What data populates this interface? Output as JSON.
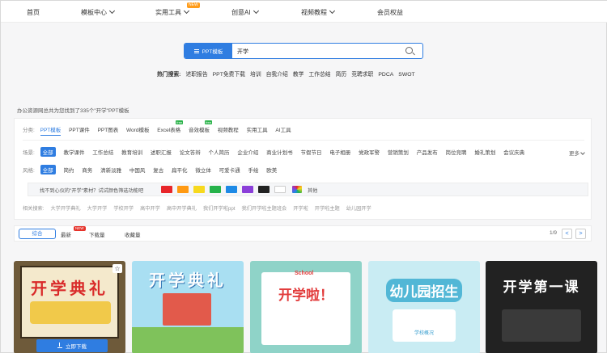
{
  "nav": {
    "items": [
      {
        "label": "首页",
        "chevron": false
      },
      {
        "label": "模板中心",
        "chevron": true
      },
      {
        "label": "实用工具",
        "chevron": true
      },
      {
        "label": "创意AI",
        "chevron": true
      },
      {
        "label": "视频教程",
        "chevron": true
      },
      {
        "label": "会员权益",
        "chevron": false
      }
    ],
    "new_badge": "NEW"
  },
  "search": {
    "type_label": "PPT模板",
    "value": "开学"
  },
  "hot": {
    "label": "热门搜索:",
    "tags": [
      "述职报告",
      "PPT免费下载",
      "培训",
      "自我介绍",
      "教学",
      "工作总结",
      "简历",
      "竞聘求职",
      "PDCA",
      "SWOT"
    ]
  },
  "result_text": "办公资源网总共为您找到了335个\"开学\"PPT模板",
  "filters": {
    "category": {
      "label": "分类:",
      "options": [
        "PPT模板",
        "PPT课件",
        "PPT图表",
        "Word模板",
        "Excel表格",
        "音效模板",
        "视频教程",
        "实用工具",
        "AI工具"
      ],
      "free_badge": "free"
    },
    "scene": {
      "label": "场景:",
      "options": [
        "全部",
        "教学课件",
        "工作总结",
        "教育培训",
        "述职汇报",
        "论文答辩",
        "个人简历",
        "企业介绍",
        "商业计划书",
        "节假节日",
        "电子相册",
        "党政军警",
        "营销策划",
        "产品发布",
        "岗位竞聘",
        "婚礼策划",
        "会议庆典"
      ],
      "more": "更多"
    },
    "style": {
      "label": "风格:",
      "options": [
        "全部",
        "简约",
        "商务",
        "清新淡雅",
        "中国风",
        "复古",
        "扁平化",
        "微立体",
        "可爱卡通",
        "手绘",
        "欧美"
      ]
    },
    "color": {
      "question": "找不到心仪的\"开学\"素材？试试颜色筛选功能吧",
      "swatches": [
        "#e8262a",
        "#ff9a13",
        "#f7d91e",
        "#27b34b",
        "#1e8ae6",
        "#8b3fd9",
        "#222222",
        "#ffffff"
      ],
      "other": "其他"
    },
    "related": {
      "label": "相关搜索:",
      "tags": [
        "大学开学典礼",
        "大学开学",
        "学校开学",
        "高中开学",
        "高中开学典礼",
        "我们开学啦ppt",
        "我们开学啦主题班会",
        "开学啦",
        "开学啦主题",
        "幼儿园开学"
      ]
    }
  },
  "sort": {
    "items": [
      "综合",
      "最新",
      "下载量",
      "收藏量"
    ],
    "new_badge": "NEW",
    "page_text": "1/9",
    "prev": "<",
    "next": ">"
  },
  "cards": [
    {
      "title": "开学典礼",
      "style": "chalk",
      "download_label": "立即下载"
    },
    {
      "title": "开学典礼",
      "style": "school"
    },
    {
      "title": "开学啦！",
      "style": "school-blue",
      "badge": "School"
    },
    {
      "title": "幼儿园招生",
      "style": "kindergarten",
      "sub": "学校概况"
    },
    {
      "title": "开学第一课",
      "style": "blackboard"
    }
  ]
}
